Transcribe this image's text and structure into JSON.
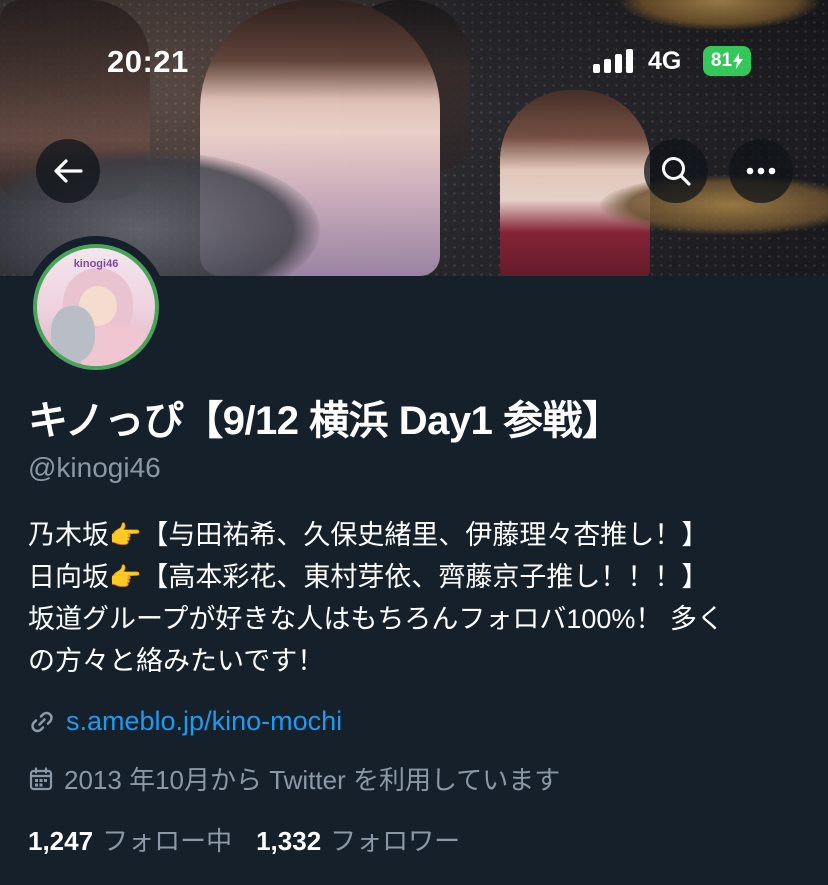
{
  "status_bar": {
    "time": "20:21",
    "network": "4G",
    "battery": "81"
  },
  "header": {
    "back_icon": "arrow-left-icon",
    "search_icon": "search-icon",
    "more_icon": "more-horizontal-icon"
  },
  "avatar": {
    "badge_text": "kinogi46"
  },
  "profile": {
    "display_name": "キノっぴ【9/12 横浜 Day1 参戦】",
    "handle": "@kinogi46",
    "bio": {
      "line1_a": "乃木坂",
      "line1_b": "【与田祐希、久保史緒里、伊藤理々杏推し！】",
      "line2_a": "日向坂",
      "line2_b": "【高本彩花、東村芽依、齊藤京子推し！！！】",
      "line3": "坂道グループが好きな人はもちろんフォロバ100%！ 多く",
      "line4": "の方々と絡みたいです！",
      "emoji": "👉"
    },
    "link": "s.ameblo.jp/kino-mochi",
    "joined": "2013 年10月から Twitter を利用しています",
    "following_count": "1,247",
    "following_label": "フォロー中",
    "followers_count": "1,332",
    "followers_label": "フォロワー"
  },
  "colors": {
    "background": "#15202b",
    "link": "#1d9bf0",
    "secondary_text": "#8b98a5",
    "battery": "#34c759",
    "avatar_ring": "#4aa35a"
  }
}
